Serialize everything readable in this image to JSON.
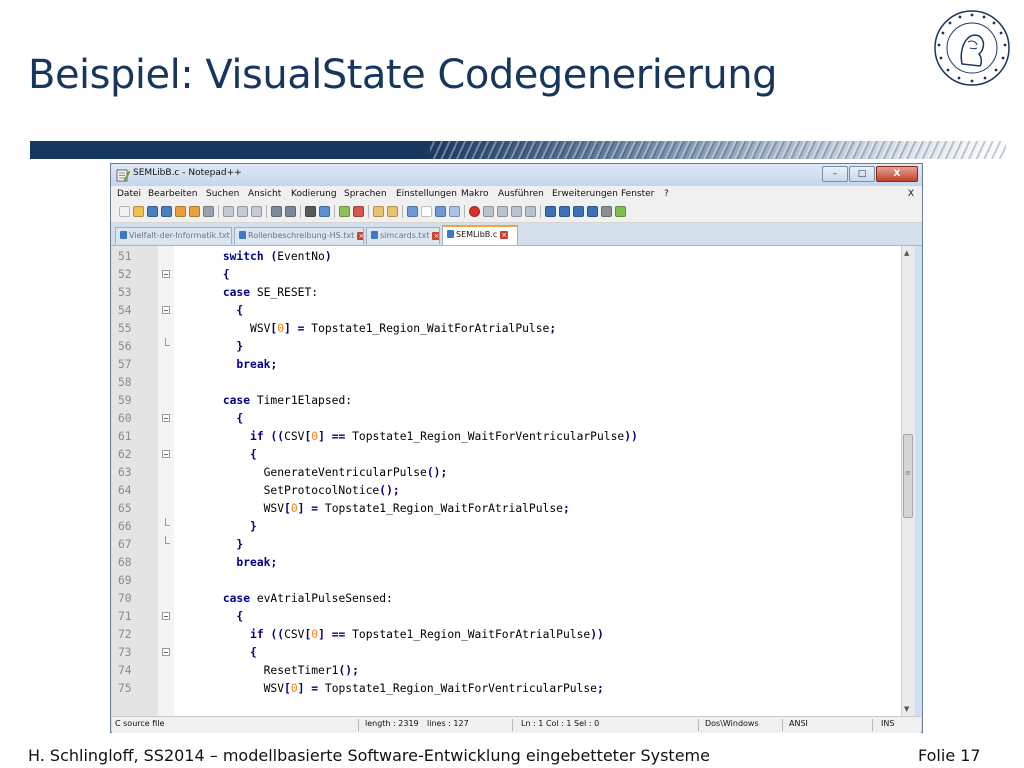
{
  "slide": {
    "title": "Beispiel: VisualState Codegenerierung",
    "footer_left": "H. Schlingloff, SS2014 – modellbasierte Software-Entwicklung eingebetteter Systeme",
    "footer_right": "Folie 17",
    "logo_icon": "humboldt-university-seal-icon",
    "accent_color": "#17365d"
  },
  "window": {
    "title": "SEMLibB.c - Notepad++",
    "minimize_label": "–",
    "maximize_label": "□",
    "close_label": "X"
  },
  "menu": {
    "items": [
      "Datei",
      "Bearbeiten",
      "Suchen",
      "Ansicht",
      "Kodierung",
      "Sprachen",
      "Einstellungen",
      "Makro",
      "Ausführen",
      "Erweiterungen",
      "Fenster",
      "?"
    ],
    "close_label": "X"
  },
  "tabs": [
    {
      "label": "Vielfalt-der-Informatik.txt",
      "active": false
    },
    {
      "label": "Rollenbeschreibung-HS.txt",
      "active": false
    },
    {
      "label": "simcards.txt",
      "active": false
    },
    {
      "label": "SEMLibB.c",
      "active": true
    }
  ],
  "editor": {
    "lines": [
      {
        "n": "51",
        "text": "switch (EventNo)"
      },
      {
        "n": "52",
        "text": "{"
      },
      {
        "n": "53",
        "text": "case SE_RESET:"
      },
      {
        "n": "54",
        "text": "  {"
      },
      {
        "n": "55",
        "text": "    WSV[0] = Topstate1_Region_WaitForAtrialPulse;"
      },
      {
        "n": "56",
        "text": "  }"
      },
      {
        "n": "57",
        "text": "  break;"
      },
      {
        "n": "58",
        "text": ""
      },
      {
        "n": "59",
        "text": "case Timer1Elapsed:"
      },
      {
        "n": "60",
        "text": "  {"
      },
      {
        "n": "61",
        "text": "    if ((CSV[0] == Topstate1_Region_WaitForVentricularPulse))"
      },
      {
        "n": "62",
        "text": "    {"
      },
      {
        "n": "63",
        "text": "      GenerateVentricularPulse();"
      },
      {
        "n": "64",
        "text": "      SetProtocolNotice();"
      },
      {
        "n": "65",
        "text": "      WSV[0] = Topstate1_Region_WaitForAtrialPulse;"
      },
      {
        "n": "66",
        "text": "    }"
      },
      {
        "n": "67",
        "text": "  }"
      },
      {
        "n": "68",
        "text": "  break;"
      },
      {
        "n": "69",
        "text": ""
      },
      {
        "n": "70",
        "text": "case evAtrialPulseSensed:"
      },
      {
        "n": "71",
        "text": "  {"
      },
      {
        "n": "72",
        "text": "    if ((CSV[0] == Topstate1_Region_WaitForAtrialPulse))"
      },
      {
        "n": "73",
        "text": "    {"
      },
      {
        "n": "74",
        "text": "      ResetTimer1();"
      },
      {
        "n": "75",
        "text": "      WSV[0] = Topstate1_Region_WaitForVentricularPulse;"
      }
    ]
  },
  "status": {
    "file_type": "C source file",
    "length": "length : 2319",
    "lines": "lines : 127",
    "position": "Ln : 1   Col : 1   Sel : 0",
    "eol": "Dos\\Windows",
    "encoding": "ANSI",
    "mode": "INS"
  }
}
